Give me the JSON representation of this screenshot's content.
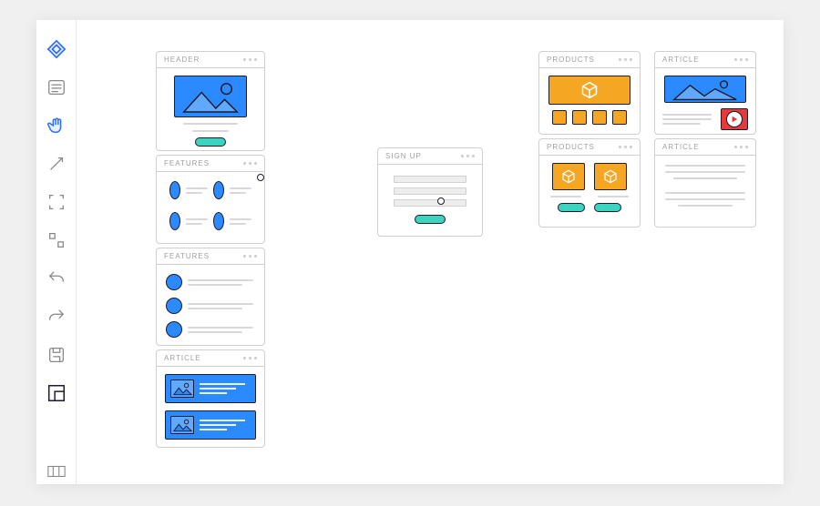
{
  "toolbar": {
    "tools": [
      {
        "name": "shape-icon",
        "active": true
      },
      {
        "name": "text-panel-icon",
        "active": false
      },
      {
        "name": "hand-icon",
        "active": true
      },
      {
        "name": "pointer-icon",
        "active": false
      },
      {
        "name": "frame-icon",
        "active": false
      },
      {
        "name": "crop-icon",
        "active": false
      },
      {
        "name": "undo-icon",
        "active": false
      },
      {
        "name": "redo-icon",
        "active": false
      },
      {
        "name": "save-icon",
        "active": false
      },
      {
        "name": "layout-icon",
        "active": false
      }
    ],
    "footer_tool": {
      "name": "properties-view-icon"
    }
  },
  "blocks": {
    "header": {
      "title": "HEADER"
    },
    "features_grid": {
      "title": "FEATURES"
    },
    "features_list": {
      "title": "FEATURES"
    },
    "article_cards": {
      "title": "ARTICLE"
    },
    "signup": {
      "title": "SIGN UP"
    },
    "products_top": {
      "title": "PRODUCTS"
    },
    "products_bottom": {
      "title": "PRODUCTS"
    },
    "article_side": {
      "title": "ARTICLE"
    },
    "article_side2": {
      "title": "ARTICLE"
    }
  },
  "colors": {
    "primary": "#2b8aff",
    "accent": "#3ad4c0",
    "warning": "#f5a623",
    "danger": "#e43a3a",
    "outline": "#1b1b2b",
    "muted": "#cfcfcf"
  },
  "connections": [
    {
      "from": "features_grid",
      "to": "signup"
    },
    {
      "from": "signup",
      "to": "products_top"
    }
  ]
}
